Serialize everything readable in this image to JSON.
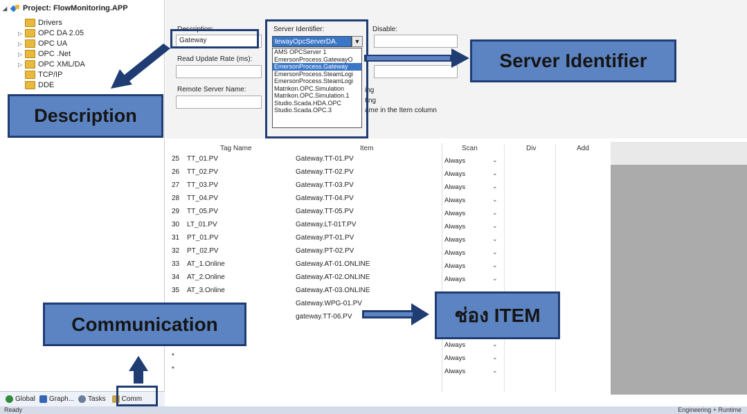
{
  "tree": {
    "project_label": "Project: FlowMonitoring.APP",
    "items": [
      "Drivers",
      "OPC DA 2.05",
      "OPC UA",
      "OPC .Net",
      "OPC XML/DA",
      "TCP/IP",
      "DDE"
    ]
  },
  "tabs": [
    "Global",
    "Graph...",
    "Tasks",
    "Comm"
  ],
  "status": {
    "left": "Ready",
    "right": "Engineering + Runtime"
  },
  "form": {
    "description_label": "Description:",
    "description_value": "Gateway",
    "server_identifier_label": "Server Identifier:",
    "server_identifier_value": "tewayOpcServerDA.",
    "disable_label": "Disable:",
    "read_update_label": "Read Update Rate (ms):",
    "remote_server_label": "Remote Server Name:",
    "option_fragments": [
      "ing",
      "ting",
      "ame in the Item column"
    ]
  },
  "server_options": [
    "AMS OPCServer 1",
    "EmersonProcess.GatewayO",
    "EmersonProcess.Gateway",
    "EmersonProcess.SteamLogi",
    "EmersonProcess.SteamLogi",
    "Matrikon.OPC.Simulation",
    "Matrikon.OPC.Simulation.1",
    "Studio.Scada.HDA.OPC",
    "Studio.Scada.OPC.3"
  ],
  "server_options_selected_index": 2,
  "grid": {
    "headers": [
      "Tag Name",
      "Item",
      "Scan",
      "Div",
      "Add"
    ],
    "rows": [
      {
        "num": "25",
        "tag": "TT_01.PV",
        "item": "Gateway.TT-01.PV",
        "scan": "Always"
      },
      {
        "num": "26",
        "tag": "TT_02.PV",
        "item": "Gateway.TT-02.PV",
        "scan": "Always"
      },
      {
        "num": "27",
        "tag": "TT_03.PV",
        "item": "Gateway.TT-03.PV",
        "scan": "Always"
      },
      {
        "num": "28",
        "tag": "TT_04.PV",
        "item": "Gateway.TT-04.PV",
        "scan": "Always"
      },
      {
        "num": "29",
        "tag": "TT_05.PV",
        "item": "Gateway.TT-05.PV",
        "scan": "Always"
      },
      {
        "num": "30",
        "tag": "LT_01.PV",
        "item": "Gateway.LT-01T.PV",
        "scan": "Always"
      },
      {
        "num": "31",
        "tag": "PT_01.PV",
        "item": "Gateway.PT-01.PV",
        "scan": "Always"
      },
      {
        "num": "32",
        "tag": "PT_02.PV",
        "item": "Gateway.PT-02.PV",
        "scan": "Always"
      },
      {
        "num": "33",
        "tag": "AT_1.Online",
        "item": "Gateway.AT-01.ONLINE",
        "scan": "Always"
      },
      {
        "num": "34",
        "tag": "AT_2.Online",
        "item": "Gateway.AT-02.ONLINE",
        "scan": "Always"
      },
      {
        "num": "35",
        "tag": "AT_3.Online",
        "item": "Gateway.AT-03.ONLINE",
        "scan": ""
      },
      {
        "num": "",
        "tag": "",
        "item": "Gateway.WPG-01.PV",
        "scan": ""
      },
      {
        "num": "",
        "tag": "",
        "item": "gateway.TT-06.PV",
        "scan": ""
      },
      {
        "num": "",
        "tag": "",
        "item": "",
        "scan": "Always"
      },
      {
        "num": "*",
        "tag": "",
        "item": "",
        "scan": "Always"
      },
      {
        "num": "*",
        "tag": "",
        "item": "",
        "scan": "Always"
      },
      {
        "num": "*",
        "tag": "",
        "item": "",
        "scan": "Always"
      }
    ]
  },
  "annotations": {
    "description": "Description",
    "server_identifier": "Server Identifier",
    "communication": "Communication",
    "item_channel": "ช่อง ITEM"
  },
  "colors": {
    "callout_fill": "#5d84c2",
    "callout_border": "#1f3c73",
    "selection": "#3a76c8"
  }
}
